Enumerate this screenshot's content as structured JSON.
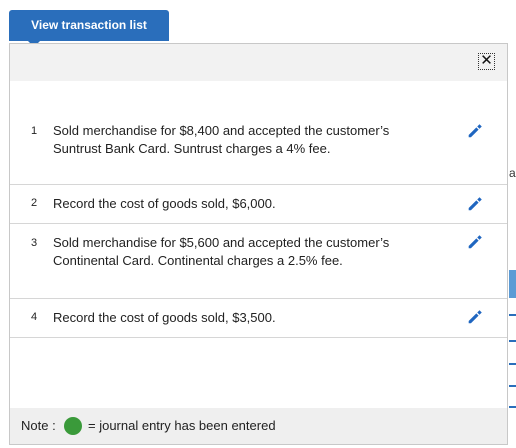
{
  "tab": {
    "label": "View transaction list"
  },
  "background": {
    "edge_text": "a"
  },
  "panel": {
    "close_glyph": "✕"
  },
  "transactions": [
    {
      "num": "1",
      "text": "Sold merchandise for $8,400 and accepted the customer’s Suntrust Bank Card. Suntrust charges a 4% fee."
    },
    {
      "num": "2",
      "text": "Record the cost of goods sold, $6,000."
    },
    {
      "num": "3",
      "text": "Sold merchandise for $5,600 and accepted the customer’s Continental Card. Continental charges a 2.5% fee."
    },
    {
      "num": "4",
      "text": "Record the cost of goods sold, $3,500."
    }
  ],
  "footer": {
    "note_label": "Note :",
    "legend": "= journal entry has been entered",
    "dot_color": "#3a9a3a"
  },
  "colors": {
    "accent": "#2a6ebb"
  },
  "icons": {
    "edit": "pencil-icon",
    "close": "close-icon"
  }
}
